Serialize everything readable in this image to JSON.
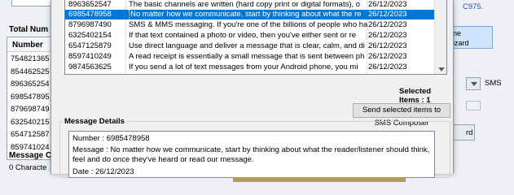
{
  "background_app": {
    "total_numbers_label": "Total Num",
    "number_column_header": "Number",
    "numbers": [
      "754821365",
      "854462525",
      "896365254",
      "698547895",
      "879698749",
      "632540215",
      "654712587",
      "859741024"
    ],
    "message_count_label": "Message C",
    "characters_label": "0 Characte",
    "top_right_link": "C975.",
    "wizard_button_label_line1": "ne",
    "wizard_button_label_line2": "izard",
    "sms_label": "SMS",
    "right_button_label": "rd"
  },
  "dialog": {
    "rows": [
      {
        "number": "8963652547",
        "message": "The basic channels are written (hard copy print or digital formats), o",
        "date": "26/12/2023",
        "selected": false
      },
      {
        "number": "6985478958",
        "message": "No matter how we communicate, start by thinking about what the re",
        "date": "26/12/2023",
        "selected": true
      },
      {
        "number": "8796987490",
        "message": "SMS & MMS messaging. If you're one of the billions of people who ha",
        "date": "26/12/2023",
        "selected": false
      },
      {
        "number": "6325402154",
        "message": " If that text contained a photo or video, then you've either sent or re",
        "date": "26/12/2023",
        "selected": false
      },
      {
        "number": "6547125879",
        "message": "Use direct language and deliver a message that is clear, calm, and di",
        "date": "26/12/2023",
        "selected": false
      },
      {
        "number": "8597410249",
        "message": "A read receipt is essentially a small message that is sent between ph",
        "date": "26/12/2023",
        "selected": false
      },
      {
        "number": "9874563625",
        "message": "If you send a lot of text messages from your Android phone, you mi",
        "date": "26/12/2023",
        "selected": false
      }
    ],
    "selected_items_text": "Selected Items : 1",
    "send_button_label": "Send selected items to SMS Composer",
    "details_legend": "Message Details",
    "detail_number_line": "Number   :  6985478958",
    "detail_message_line1": "Message  :  No matter how we communicate, start by thinking about what the reader/listener should think,",
    "detail_message_line2": "feel and do once they've heard or read our message.",
    "detail_date_line": "Date       :  26/12/2023"
  },
  "colors": {
    "selection": "#0078d7",
    "link": "#2b57b8",
    "decor_stripe": "#b39c58"
  }
}
